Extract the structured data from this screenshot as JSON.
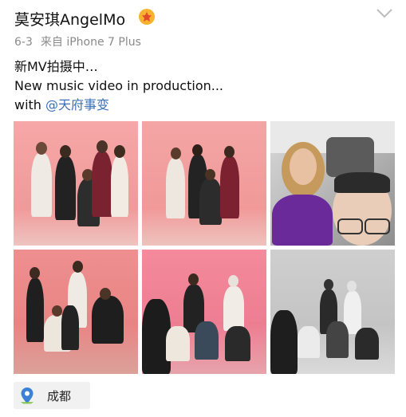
{
  "post": {
    "author": "莫安琪AngelMo",
    "date": "6-3",
    "source": "来自 iPhone 7 Plus",
    "lines": [
      "新MV拍摄中…",
      "New music video in production..."
    ],
    "with_prefix": "with ",
    "mention": "@天府事变",
    "location": "成都"
  },
  "photos": [
    {
      "name": "photo-group-standing",
      "tone": "pink"
    },
    {
      "name": "photo-group-posing",
      "tone": "pink"
    },
    {
      "name": "photo-car-selfie",
      "tone": "color"
    },
    {
      "name": "photo-dancers-rehearsal",
      "tone": "red"
    },
    {
      "name": "photo-dancers-crouching",
      "tone": "pink"
    },
    {
      "name": "photo-dancers-bw",
      "tone": "gray"
    }
  ],
  "colors": {
    "mention": "#3a6fb6",
    "meta": "#8a8a8a",
    "location_bg": "#f1f1f1",
    "pin": "#3b82d6"
  },
  "icons": [
    "vip-badge-icon",
    "chevron-down-icon",
    "location-pin-icon"
  ]
}
